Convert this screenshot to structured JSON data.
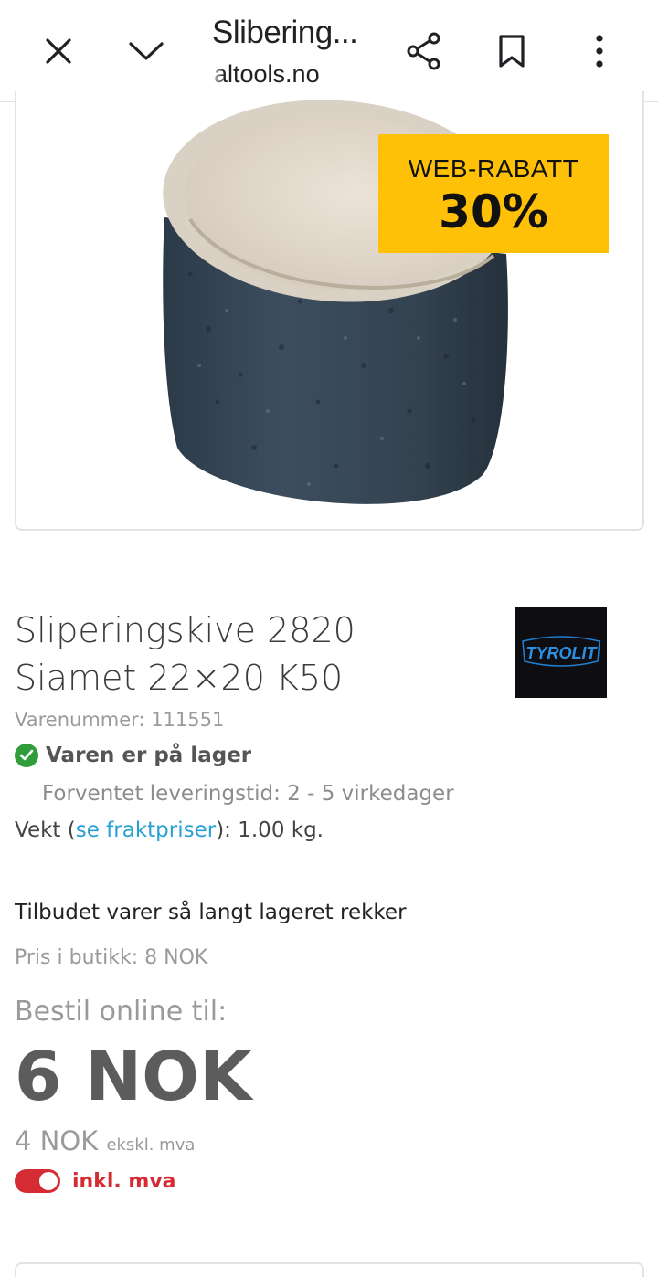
{
  "browser": {
    "title": "Slibering...",
    "url": "altools.no",
    "icons": [
      "close-icon",
      "chevron-down-icon",
      "share-icon",
      "bookmark-icon",
      "more-vert-icon"
    ]
  },
  "promo": {
    "line1": "WEB-RABATT",
    "line2": "30%",
    "color": "#ffc107"
  },
  "product": {
    "title_line1": "Sliperingskive 2820",
    "title_line2": "Siamet 22×20 K50",
    "brand": "TYROLIT",
    "sku_label": "Varenummer:",
    "sku": "111551",
    "stock_label": "Varen er på lager",
    "delivery": "Forventet leveringstid: 2 - 5 virkedager",
    "weight_prefix": "Vekt (",
    "weight_link": "se fraktpriser",
    "weight_suffix": "): 1.00 kg."
  },
  "pricing": {
    "offer_note": "Tilbudet varer så langt lageret rekker",
    "store_price": "Pris i butikk: 8 NOK",
    "order_online": "Bestil online til:",
    "price": "6 NOK",
    "ex_vat_value": "4 NOK",
    "ex_vat_label": "ekskl. mva",
    "vat_toggle_label": "inkl. mva",
    "vat_toggle_on": true,
    "accent": "#d52b32"
  }
}
